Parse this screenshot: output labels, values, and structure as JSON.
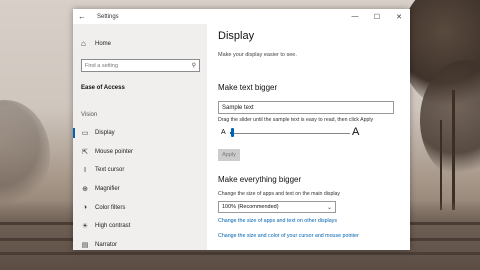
{
  "window": {
    "title": "Settings",
    "back_icon": "back-arrow-icon",
    "minimize_glyph": "—",
    "maximize_glyph": "☐",
    "close_glyph": "✕"
  },
  "sidebar": {
    "home_label": "Home",
    "search_placeholder": "Find a setting",
    "section_title": "Ease of Access",
    "group_label": "Vision",
    "items": [
      {
        "label": "Display",
        "icon": "display-icon",
        "glyph": "▭",
        "selected": true
      },
      {
        "label": "Mouse pointer",
        "icon": "mouse-pointer-icon",
        "glyph": "⇱"
      },
      {
        "label": "Text cursor",
        "icon": "text-cursor-icon",
        "glyph": "Ⅰ"
      },
      {
        "label": "Magnifier",
        "icon": "magnifier-icon",
        "glyph": "⊕"
      },
      {
        "label": "Color filters",
        "icon": "color-filters-icon",
        "glyph": "◑"
      },
      {
        "label": "High contrast",
        "icon": "high-contrast-icon",
        "glyph": "☀"
      },
      {
        "label": "Narrator",
        "icon": "narrator-icon",
        "glyph": "▤"
      }
    ]
  },
  "main": {
    "title": "Display",
    "subtitle": "Make your display easier to see.",
    "text_bigger": {
      "heading": "Make text bigger",
      "sample_value": "Sample text",
      "hint": "Drag the slider until the sample text is easy to read, then click Apply",
      "slider_small_label": "A",
      "slider_big_label": "A",
      "slider_value_percent": 0,
      "apply_label": "Apply"
    },
    "everything_bigger": {
      "heading": "Make everything bigger",
      "change_label": "Change the size of apps and text on the main display",
      "dropdown_value": "100% (Recommended)",
      "link1": "Change the size of apps and text on other displays",
      "link2": "Change the size and color of your cursor and mouse pointer"
    }
  },
  "colors": {
    "accent": "#0063b1",
    "sidebar_bg": "#eeece9",
    "window_bg": "#ffffff"
  }
}
